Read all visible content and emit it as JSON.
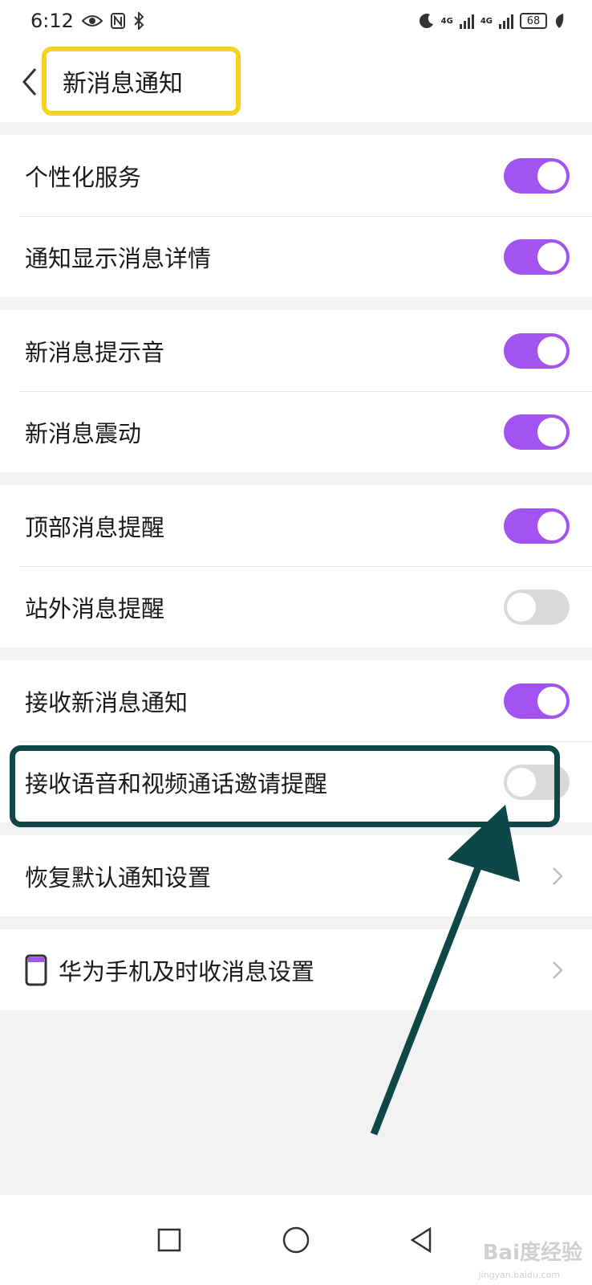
{
  "status_bar": {
    "time": "6:12",
    "network_label_1": "4G",
    "network_label_2": "4G",
    "battery": "68"
  },
  "header": {
    "title": "新消息通知"
  },
  "groups": [
    {
      "items": [
        {
          "label": "个性化服务",
          "toggle": true
        },
        {
          "label": "通知显示消息详情",
          "toggle": true
        }
      ]
    },
    {
      "items": [
        {
          "label": "新消息提示音",
          "toggle": true
        },
        {
          "label": "新消息震动",
          "toggle": true
        }
      ]
    },
    {
      "items": [
        {
          "label": "顶部消息提醒",
          "toggle": true
        },
        {
          "label": "站外消息提醒",
          "toggle": false
        }
      ]
    },
    {
      "items": [
        {
          "label": "接收新消息通知",
          "toggle": true
        },
        {
          "label": "接收语音和视频通话邀请提醒",
          "toggle": false
        }
      ]
    },
    {
      "items": [
        {
          "label": "恢复默认通知设置"
        }
      ]
    },
    {
      "items": [
        {
          "label": "华为手机及时收消息设置",
          "icon": "phone-icon"
        }
      ]
    }
  ],
  "watermark": {
    "text": "Bai度经验",
    "sub": "jingyan.baidu.com"
  },
  "colors": {
    "toggle_on": "#a354f0",
    "toggle_off": "#d9d9d9",
    "title_highlight": "#f5d31a",
    "annotation": "#0d4747"
  },
  "icons": [
    "back-icon",
    "chevron-right-icon",
    "phone-icon",
    "square-nav-icon",
    "circle-nav-icon",
    "triangle-back-nav-icon"
  ]
}
